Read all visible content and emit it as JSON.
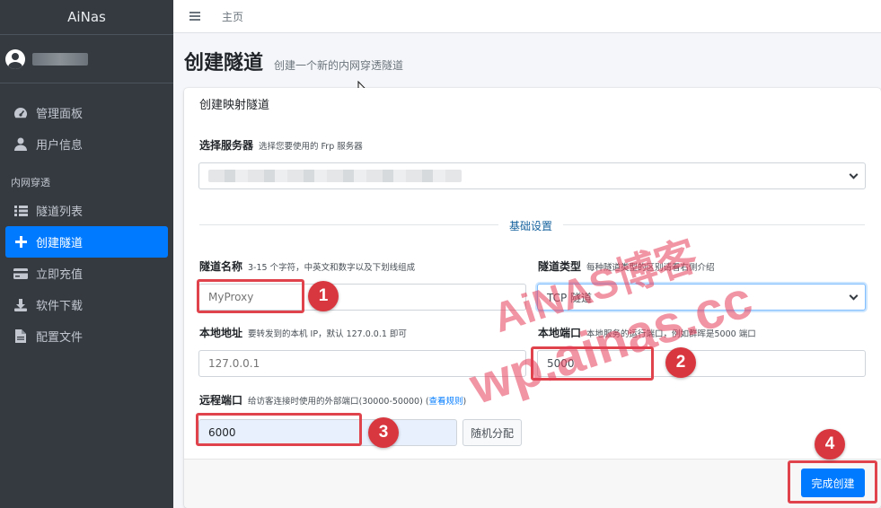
{
  "sidebar": {
    "brand": "AiNas",
    "items_top": [
      {
        "label": "管理面板"
      },
      {
        "label": "用户信息"
      }
    ],
    "section": "内网穿透",
    "items": [
      {
        "label": "隧道列表"
      },
      {
        "label": "创建隧道"
      },
      {
        "label": "立即充值"
      },
      {
        "label": "软件下载"
      },
      {
        "label": "配置文件"
      }
    ]
  },
  "topbar": {
    "home": "主页"
  },
  "page": {
    "title": "创建隧道",
    "subtitle": "创建一个新的内网穿透隧道"
  },
  "card": {
    "title": "创建映射隧道",
    "server": {
      "label": "选择服务器",
      "hint": "选择您要使用的 Frp 服务器"
    },
    "divider": "基础设置",
    "name": {
      "label": "隧道名称",
      "hint": "3-15 个字符，中英文和数字以及下划线组成",
      "placeholder": "MyProxy"
    },
    "type": {
      "label": "隧道类型",
      "hint": "每种隧道类型的区别请看右侧介绍",
      "value": "TCP 隧道"
    },
    "local_addr": {
      "label": "本地地址",
      "hint": "要转发到的本机 IP，默认 127.0.0.1 即可",
      "placeholder": "127.0.0.1"
    },
    "local_port": {
      "label": "本地端口",
      "hint": "本地服务的运行端口，例如群晖是5000 端口",
      "value": "5000"
    },
    "remote_port": {
      "label": "远程端口",
      "hint": "给访客连接时使用的外部端口(30000-50000) (",
      "hint_link": "查看规则",
      "hint_end": ")",
      "value": "6000",
      "random_label": "随机分配"
    },
    "submit": "完成创建"
  },
  "annotations": {
    "badges": [
      "1",
      "2",
      "3",
      "4"
    ],
    "highlight_color": "#e0434c",
    "badge_color": "#d9373f"
  },
  "watermark": {
    "line1": "AiNAS博客",
    "line2": "wp.ainas.cc"
  },
  "colors": {
    "accent": "#007bff",
    "sidebar": "#343a40"
  }
}
